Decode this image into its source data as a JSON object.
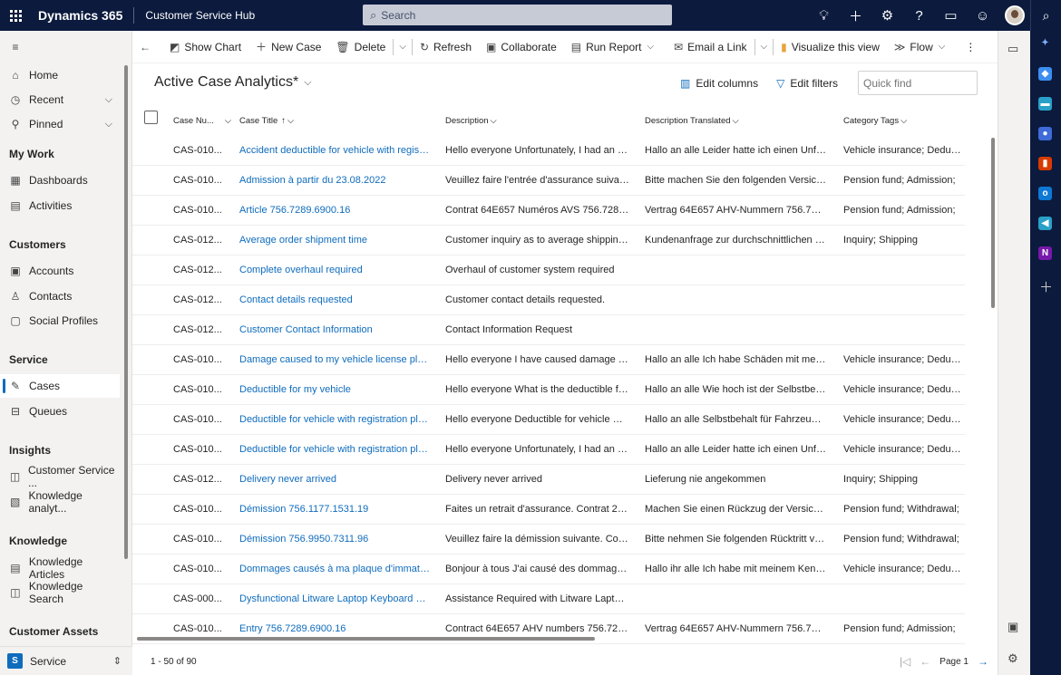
{
  "topbar": {
    "brand": "Dynamics 365",
    "app_name": "Customer Service Hub",
    "search_placeholder": "Search",
    "icons": [
      "lightbulb-icon",
      "plus-icon",
      "gear-icon",
      "help-icon",
      "chat-icon",
      "smiley-icon",
      "avatar",
      "search-icon"
    ]
  },
  "nav": {
    "home": "Home",
    "recent": "Recent",
    "pinned": "Pinned",
    "my_work": "My Work",
    "dashboards": "Dashboards",
    "activities": "Activities",
    "customers": "Customers",
    "accounts": "Accounts",
    "contacts": "Contacts",
    "social_profiles": "Social Profiles",
    "service": "Service",
    "cases": "Cases",
    "queues": "Queues",
    "insights": "Insights",
    "customer_service": "Customer Service ...",
    "knowledge_analytics": "Knowledge analyt...",
    "knowledge": "Knowledge",
    "knowledge_articles": "Knowledge Articles",
    "knowledge_search": "Knowledge Search",
    "customer_assets": "Customer Assets",
    "area_badge": "S",
    "area_name": "Service"
  },
  "commands": {
    "show_chart": "Show Chart",
    "new_case": "New Case",
    "delete": "Delete",
    "refresh": "Refresh",
    "collaborate": "Collaborate",
    "run_report": "Run Report",
    "email_link": "Email a Link",
    "visualize": "Visualize this view",
    "flow": "Flow"
  },
  "view": {
    "title": "Active Case Analytics*",
    "edit_columns": "Edit columns",
    "edit_filters": "Edit filters",
    "quick_find_placeholder": "Quick find"
  },
  "columns": {
    "case_number": "Case Nu...",
    "case_title": "Case Title",
    "description": "Description",
    "description_translated": "Description Translated",
    "category_tags": "Category Tags"
  },
  "rows": [
    {
      "num": "CAS-010...",
      "title": "Accident deductible for vehicle with registra...",
      "desc": "Hello everyone Unfortunately, I had an ac...",
      "trans": "Hallo an alle Leider hatte ich einen Unfall ...",
      "tags": "Vehicle insurance; Deductible;"
    },
    {
      "num": "CAS-010...",
      "title": "Admission à partir du 23.08.2022",
      "desc": "Veuillez faire l'entrée d'assurance suivante...",
      "trans": "Bitte machen Sie den folgenden Versicher...",
      "tags": "Pension fund; Admission;"
    },
    {
      "num": "CAS-010...",
      "title": "Article 756.7289.6900.16",
      "desc": "Contrat 64E657 Numéros AVS 756.7289.6...",
      "trans": "Vertrag 64E657 AHV-Nummern 756.7289....",
      "tags": "Pension fund; Admission;"
    },
    {
      "num": "CAS-012...",
      "title": "Average order shipment time",
      "desc": "Customer inquiry as to average shipping t...",
      "trans": "Kundenanfrage zur durchschnittlichen Lief...",
      "tags": "Inquiry; Shipping"
    },
    {
      "num": "CAS-012...",
      "title": "Complete overhaul required",
      "desc": "Overhaul of customer system required",
      "trans": "",
      "tags": ""
    },
    {
      "num": "CAS-012...",
      "title": "Contact details requested",
      "desc": "Customer contact details requested.",
      "trans": "",
      "tags": ""
    },
    {
      "num": "CAS-012...",
      "title": "Customer Contact Information",
      "desc": "Contact Information Request",
      "trans": "",
      "tags": ""
    },
    {
      "num": "CAS-010...",
      "title": "Damage caused to my vehicle license plate ...",
      "desc": "Hello everyone I have caused damage wit...",
      "trans": "Hallo an alle Ich habe Schäden mit meine...",
      "tags": "Vehicle insurance; Deductible;"
    },
    {
      "num": "CAS-010...",
      "title": "Deductible for my vehicle",
      "desc": "Hello everyone What is the deductible for ...",
      "trans": "Hallo an alle Wie hoch ist der Selbstbehalt...",
      "tags": "Vehicle insurance; Deductible;"
    },
    {
      "num": "CAS-010...",
      "title": "Deductible for vehicle with registration plat...",
      "desc": "Hello everyone Deductible for vehicle wit...",
      "trans": "Hallo an alle Selbstbehalt für Fahrzeug mit...",
      "tags": "Vehicle insurance; Deductible;"
    },
    {
      "num": "CAS-010...",
      "title": "Deductible for vehicle with registration plat...",
      "desc": "Hello everyone Unfortunately, I had an ac...",
      "trans": "Hallo an alle Leider hatte ich einen Unfall ...",
      "tags": "Vehicle insurance; Deductible;"
    },
    {
      "num": "CAS-012...",
      "title": "Delivery never arrived",
      "desc": "Delivery never arrived",
      "trans": "Lieferung nie angekommen",
      "tags": "Inquiry; Shipping"
    },
    {
      "num": "CAS-010...",
      "title": "Démission 756.1177.1531.19",
      "desc": "Faites un retrait d'assurance. Contrat 240...",
      "trans": "Machen Sie einen Rückzug der Versicheru...",
      "tags": "Pension fund; Withdrawal;"
    },
    {
      "num": "CAS-010...",
      "title": "Démission 756.9950.7311.96",
      "desc": "Veuillez faire la démission suivante. Contr...",
      "trans": "Bitte nehmen Sie folgenden Rücktritt vor. ...",
      "tags": "Pension fund; Withdrawal;"
    },
    {
      "num": "CAS-010...",
      "title": "Dommages causés à ma plaque d'immatric...",
      "desc": "Bonjour à tous J'ai causé des dommages a...",
      "trans": "Hallo ihr alle Ich habe mit meinem Kennze...",
      "tags": "Vehicle insurance; Deductible;"
    },
    {
      "num": "CAS-000...",
      "title": "Dysfunctional Litware Laptop Keyboard X105",
      "desc": "Assistance Required with Litware Laptop K...",
      "trans": "",
      "tags": ""
    },
    {
      "num": "CAS-010...",
      "title": "Entry 756.7289.6900.16",
      "desc": "Contract 64E657 AHV numbers 756.7289....",
      "trans": "Vertrag 64E657 AHV-Nummern 756.7289....",
      "tags": "Pension fund; Admission;"
    }
  ],
  "footer": {
    "count": "1 - 50 of 90",
    "page": "Page 1"
  }
}
